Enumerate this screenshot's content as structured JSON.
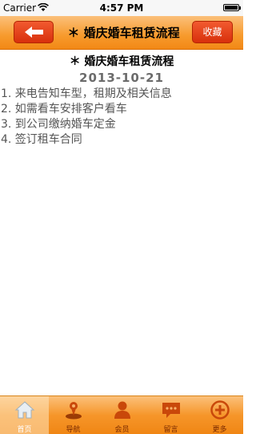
{
  "status_bar": {
    "carrier": "Carrier",
    "time": "4:57 PM"
  },
  "nav": {
    "title": "＊ 婚庆婚车租赁流程",
    "favorite_label": "收藏"
  },
  "article": {
    "title": "＊ 婚庆婚车租赁流程",
    "date": "2013-10-21",
    "steps": [
      "1. 来电告知车型，租期及相关信息",
      "2. 如需看车安排客户看车",
      "3. 到公司缴纳婚车定金",
      "4. 签订租车合同"
    ]
  },
  "tab_bar": {
    "tabs": [
      {
        "label": "首页",
        "icon": "home-icon",
        "active": true
      },
      {
        "label": "导航",
        "icon": "map-pin-icon",
        "active": false
      },
      {
        "label": "会员",
        "icon": "member-icon",
        "active": false
      },
      {
        "label": "留言",
        "icon": "message-icon",
        "active": false
      },
      {
        "label": "更多",
        "icon": "more-icon",
        "active": false
      }
    ]
  },
  "colors": {
    "nav_orange": "#f79a2c",
    "button_red": "#d8300c",
    "text_gray": "#555555"
  }
}
